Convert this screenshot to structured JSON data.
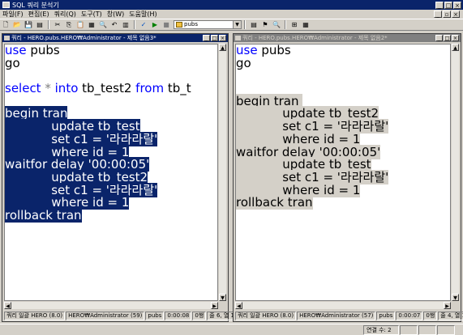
{
  "app": {
    "title": "SQL 쿼리 분석기"
  },
  "menu": [
    "파일(F)",
    "편집(E)",
    "쿼리(Q)",
    "도구(T)",
    "창(W)",
    "도움말(H)"
  ],
  "toolbar": {
    "database": "pubs"
  },
  "windows": {
    "left": {
      "title": "쿼리 - HERO.pubs.HERO₩Administrator - 제목 없음3*",
      "status": [
        "쿼리 일괄 HERO (8.0)",
        "HERO₩Administrator (59)",
        "pubs",
        "0:00:08",
        "0행",
        "줄 6, 열 1"
      ],
      "lines": [
        {
          "text": "use pubs",
          "parts": [
            {
              "t": "use",
              "c": "kw"
            },
            {
              "t": " pubs"
            }
          ]
        },
        {
          "parts": [
            {
              "t": "go"
            }
          ]
        },
        {
          "parts": [
            {
              "t": ""
            }
          ]
        },
        {
          "parts": [
            {
              "t": "select",
              "c": "kw"
            },
            {
              "t": " "
            },
            {
              "t": "*",
              "c": "op"
            },
            {
              "t": " "
            },
            {
              "t": "into",
              "c": "kw"
            },
            {
              "t": " tb_test2 "
            },
            {
              "t": "from",
              "c": "kw"
            },
            {
              "t": " tb_t"
            }
          ]
        },
        {
          "parts": [
            {
              "t": ""
            }
          ]
        },
        {
          "sel": true,
          "parts": [
            {
              "t": "begin tran"
            }
          ]
        },
        {
          "sel": true,
          "parts": [
            {
              "t": "            update tb_test"
            }
          ]
        },
        {
          "sel": true,
          "parts": [
            {
              "t": "            set c1 = '라라라랄'"
            }
          ]
        },
        {
          "sel": true,
          "parts": [
            {
              "t": "            where id = 1"
            }
          ]
        },
        {
          "sel": true,
          "parts": [
            {
              "t": "waitfor delay '00:00:05'"
            }
          ]
        },
        {
          "sel": true,
          "parts": [
            {
              "t": "            update tb_test2"
            }
          ]
        },
        {
          "sel": true,
          "parts": [
            {
              "t": "            set c1 = '라라라랄'"
            }
          ]
        },
        {
          "sel": true,
          "parts": [
            {
              "t": "            where id = 1"
            }
          ]
        },
        {
          "sel": true,
          "parts": [
            {
              "t": "rollback tran"
            }
          ]
        }
      ]
    },
    "right": {
      "title": "쿼리 - HERO.pubs.HERO₩Administrator - 제목 없음2*",
      "status": [
        "쿼리 일괄 HERO (8.0)",
        "HERO₩Administrator (57)",
        "pubs",
        "0:00:07",
        "0행",
        "줄 4, 열 1"
      ],
      "lines": [
        {
          "parts": [
            {
              "t": "use",
              "c": "kw"
            },
            {
              "t": " pubs"
            }
          ]
        },
        {
          "parts": [
            {
              "t": "go"
            }
          ]
        },
        {
          "parts": [
            {
              "t": ""
            }
          ]
        },
        {
          "parts": [
            {
              "t": ""
            }
          ]
        },
        {
          "gsel": true,
          "parts": [
            {
              "t": "begin tran "
            }
          ]
        },
        {
          "gsel": true,
          "parts": [
            {
              "t": "            update tb_test2"
            }
          ]
        },
        {
          "gsel": true,
          "parts": [
            {
              "t": "            set c1 = '라라라랄'"
            }
          ]
        },
        {
          "gsel": true,
          "parts": [
            {
              "t": "            where id = 1"
            }
          ]
        },
        {
          "gsel": true,
          "parts": [
            {
              "t": "waitfor delay '00:00:05'"
            }
          ]
        },
        {
          "gsel": true,
          "parts": [
            {
              "t": "            update tb_test"
            }
          ]
        },
        {
          "gsel": true,
          "parts": [
            {
              "t": "            set c1 = '라라라랄'"
            }
          ]
        },
        {
          "gsel": true,
          "parts": [
            {
              "t": "            where id = 1"
            }
          ]
        },
        {
          "gsel": true,
          "parts": [
            {
              "t": "rollback tran"
            }
          ]
        }
      ]
    }
  },
  "appstatus": {
    "connections": "연결 수: 2"
  }
}
